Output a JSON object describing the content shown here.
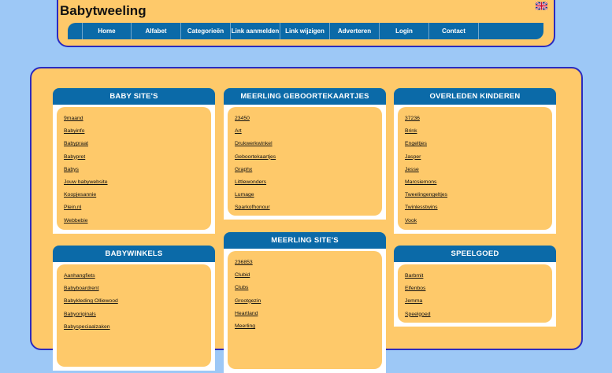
{
  "header": {
    "title": "Babytweeling",
    "flag_icon": "uk-flag-icon"
  },
  "nav": {
    "items": [
      "Home",
      "Alfabet",
      "Categorieën",
      "Link aanmelden",
      "Link wijzigen",
      "Adverteren",
      "Login",
      "Contact"
    ]
  },
  "boxes": {
    "baby_sites": {
      "title": "BABY SITE'S",
      "links": [
        "9maand",
        "Babyinfo",
        "Babypraat",
        "Babypret",
        "Babys",
        "Jouw babywebsite",
        "Koopjesannie",
        "Plein.nl",
        "Webbebie"
      ]
    },
    "meerling_kaartjes": {
      "title": "MEERLING GEBOORTEKAARTJES",
      "links": [
        "23450",
        "Art",
        "Drukwerkwinkel",
        "Geboortekaartjes",
        "Graphx",
        "Littlewonders",
        "Lumage",
        "Sparkofhonour"
      ]
    },
    "overleden": {
      "title": "OVERLEDEN KINDEREN",
      "links": [
        "37236",
        "Brink",
        "Engeltjes",
        "Jasper",
        "Jesse",
        "Marcsiemons",
        "Tweelingengeltjes",
        "Twinlesstwins",
        "Vook"
      ]
    },
    "babywinkels": {
      "title": "BABYWINKELS",
      "links": [
        "Aanhangfiets",
        "Babyboardrent",
        "Babykleding Olliewood",
        "Babyoriginals",
        "Babyspeciaalzaken"
      ]
    },
    "meerling_sites": {
      "title": "MEERLING SITE'S",
      "links": [
        "236853",
        "Clubid",
        "Clubs",
        "Grootgezin",
        "Heartland",
        "Meerling"
      ]
    },
    "speelgoed": {
      "title": "SPEELGOED",
      "links": [
        "Barbmit",
        "Elfenbos",
        "Jemma",
        "Speelgoed"
      ]
    }
  },
  "colors": {
    "background": "#9dc8f6",
    "panel": "#fec96a",
    "accent_blue": "#0b6aa8",
    "border": "#2b2bc0"
  }
}
